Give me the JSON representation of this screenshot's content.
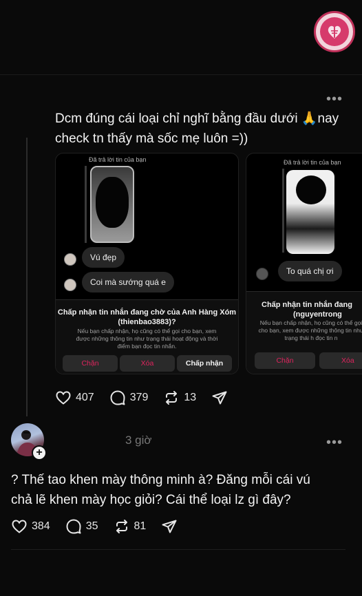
{
  "post": {
    "text_line1": "Dcm đúng cái loại chỉ nghĩ bằng đầu dưới 🙏nay",
    "text_line2": "check tn thấy mà sốc mẹ luôn =))",
    "likes": "407",
    "comments": "379",
    "reposts": "13"
  },
  "screenshots": [
    {
      "reply_label": "Đã trả lời tin của bạn",
      "messages": [
        "Vú đẹp",
        "Coi mà sướng quá e"
      ],
      "request_title_line1": "Chấp nhận tin nhắn đang chờ của Anh Hàng Xóm",
      "request_title_line2": "(thienbao3883)?",
      "request_body": "Nếu bạn chấp nhận, họ cũng có thể gọi cho bạn, xem được những thông tin như trạng thái hoạt động và thời điểm bạn đọc tin nhắn.",
      "block_label": "Chặn",
      "delete_label": "Xóa",
      "accept_label": "Chấp nhận"
    },
    {
      "reply_label": "Đã trả lời tin của bạn",
      "messages": [
        "To quá chị ơi"
      ],
      "request_title_line1": "Chấp nhận tin nhắn đang",
      "request_title_line2": "(nguyentrong",
      "request_body": "Nếu bạn chấp nhận, họ cũng có thể gọi cho bạn, xem được những thông tin như trạng thái h đọc tin n",
      "block_label": "Chặn",
      "delete_label": "Xóa"
    }
  ],
  "reply": {
    "time": "3 giờ",
    "text_line1": "? Thế tao khen mày thông minh à? Đăng mỗi cái vú",
    "text_line2": "chả lẽ khen mày học giỏi? Cái thể loại lz gì đây?",
    "likes": "384",
    "comments": "35",
    "reposts": "81"
  },
  "icons": {
    "like": "heart-icon",
    "comment": "comment-bubble-icon",
    "repost": "repost-icon",
    "share": "send-icon",
    "more": "more-dots-icon",
    "follow": "plus-icon"
  }
}
